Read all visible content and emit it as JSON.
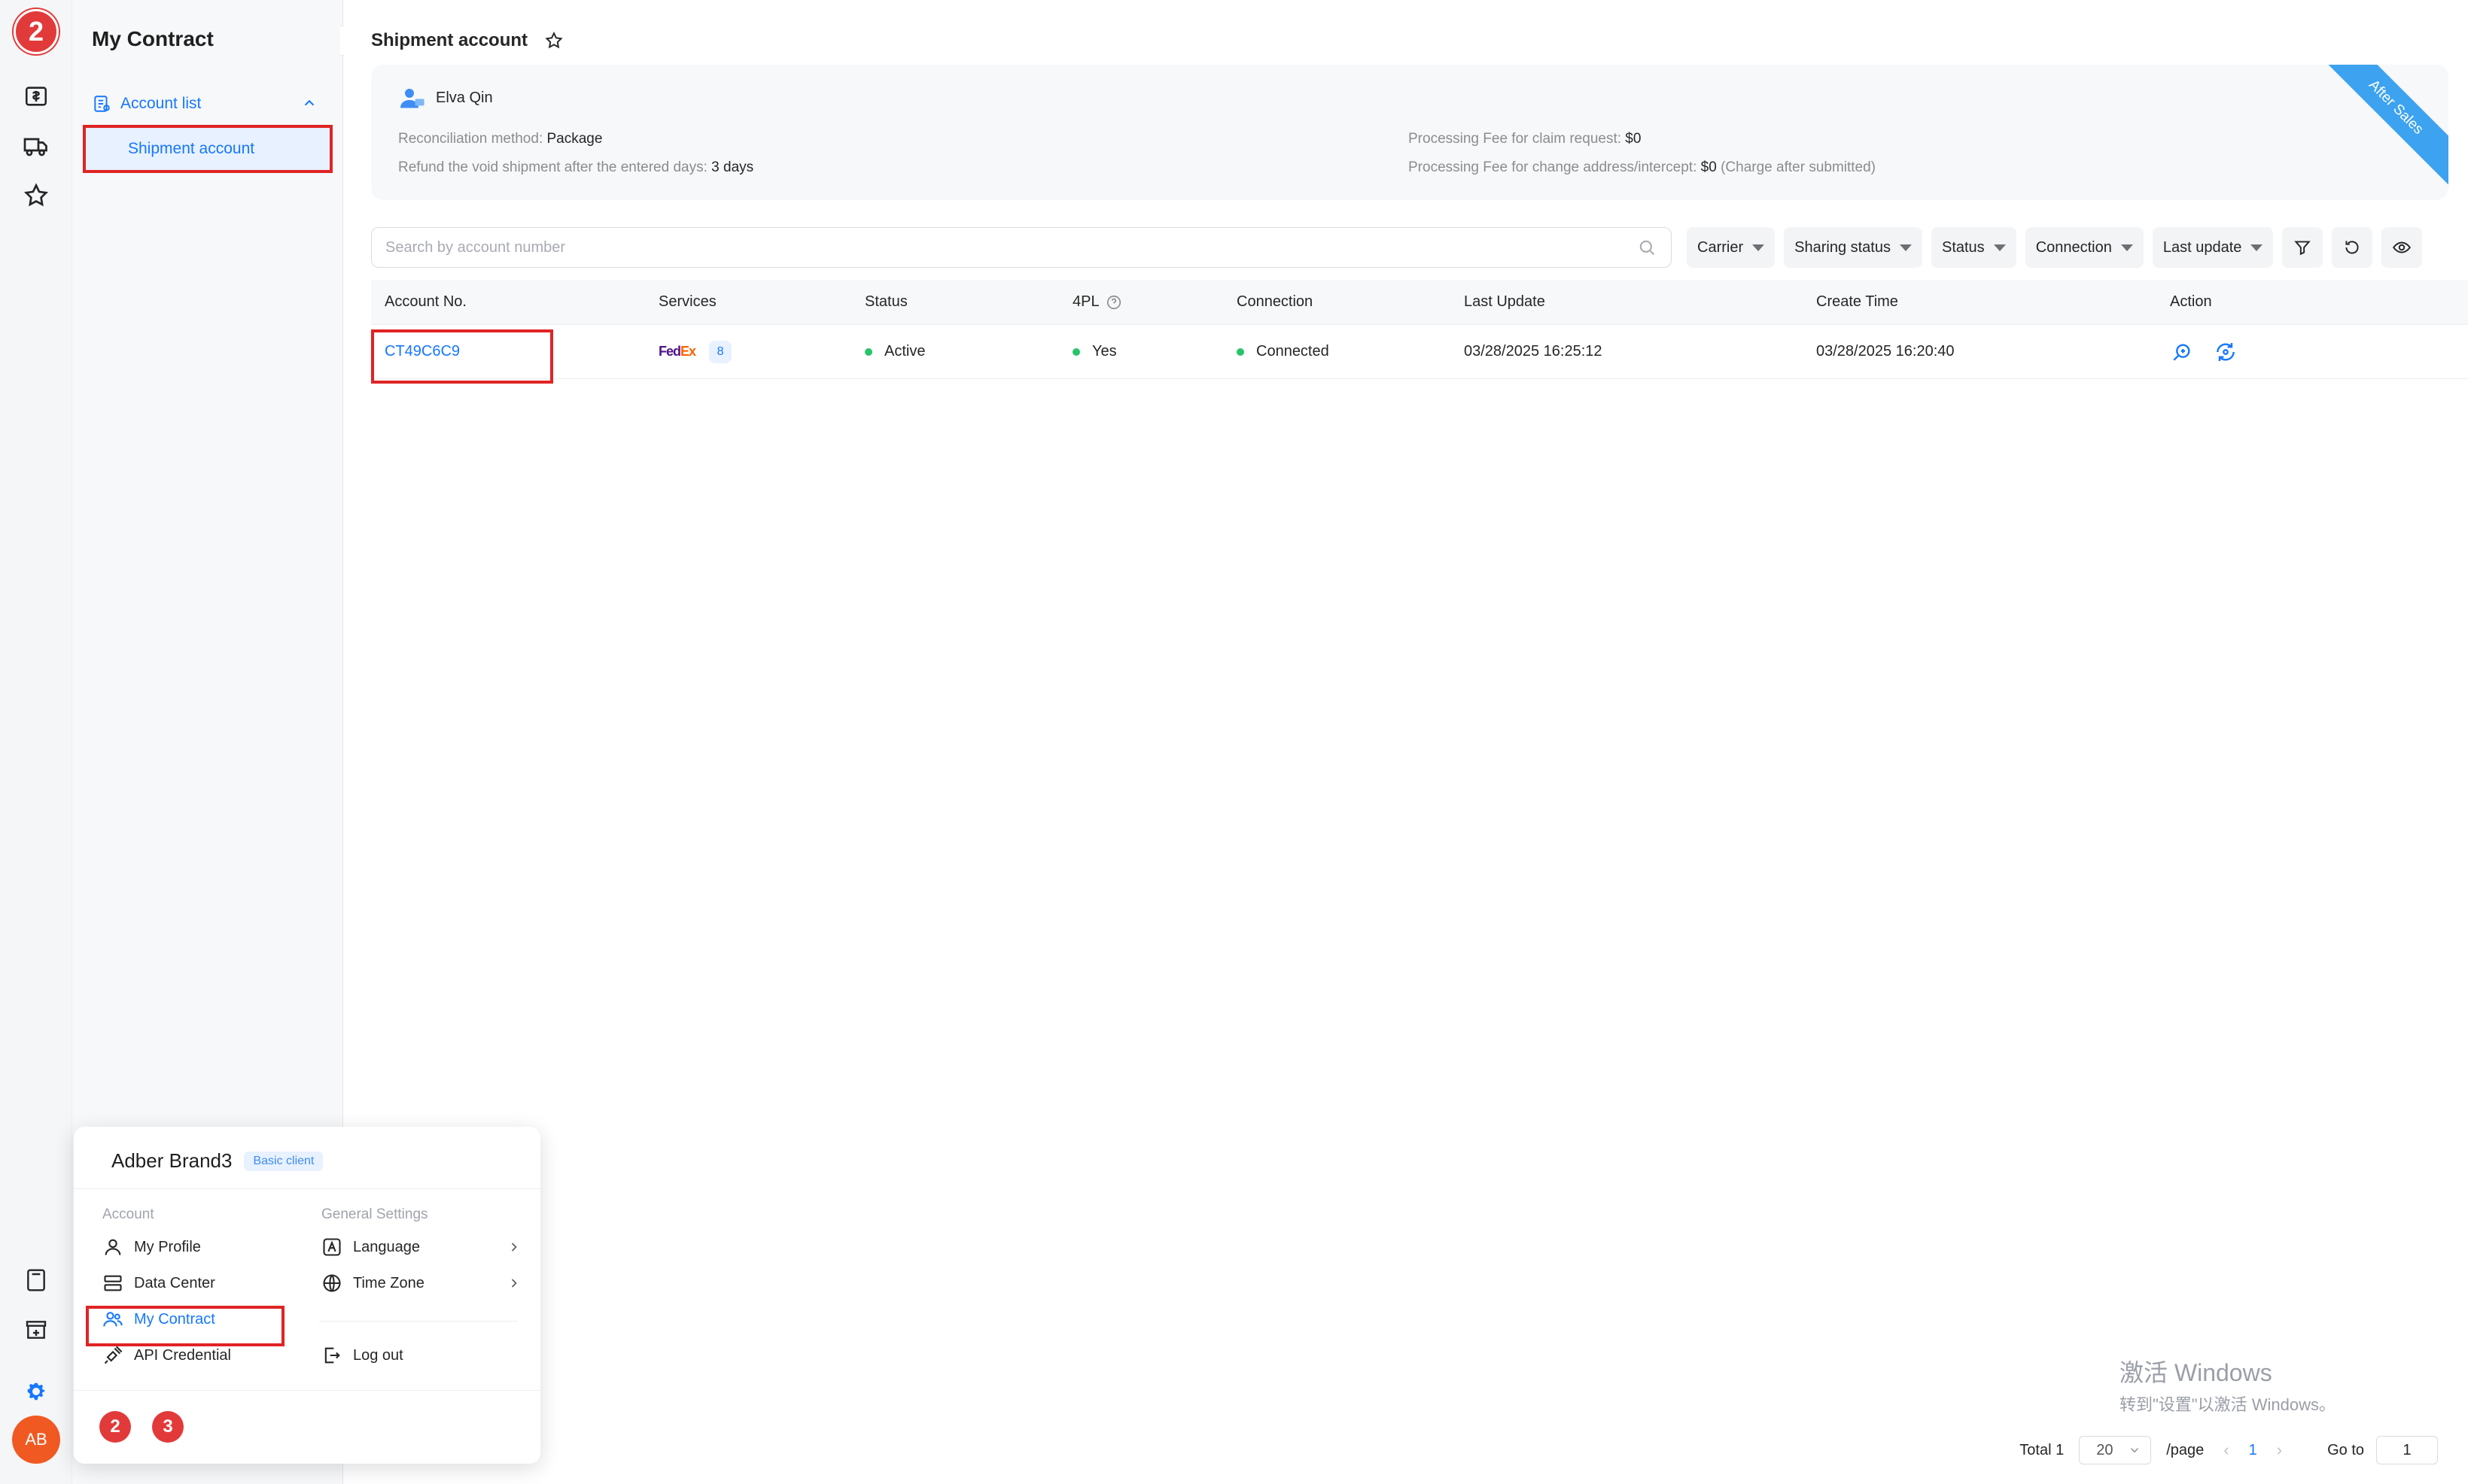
{
  "rail": {
    "badge": "2",
    "icons": [
      "billing-icon",
      "truck-icon",
      "star-icon",
      "calculator-icon",
      "store-icon",
      "settings-gear-icon"
    ],
    "avatar_text": "AB"
  },
  "subnav": {
    "title": "My Contract",
    "group_label": "Account list",
    "item_label": "Shipment account"
  },
  "main": {
    "page_title": "Shipment account",
    "info": {
      "owner": "Elva Qin",
      "reconciliation_label": "Reconciliation method:",
      "reconciliation_value": "Package",
      "refund_label": "Refund the void shipment after the entered days:",
      "refund_value": "3 days",
      "claim_fee_label": "Processing Fee for claim request:",
      "claim_fee_value": "$0",
      "change_fee_label": "Processing Fee for change address/intercept:",
      "change_fee_value": "$0",
      "change_fee_note": "(Charge after submitted)",
      "ribbon": "After Sales"
    },
    "search": {
      "placeholder": "Search by account number"
    },
    "filters": [
      "Carrier",
      "Sharing status",
      "Status",
      "Connection",
      "Last update"
    ],
    "table": {
      "headers": [
        "Account No.",
        "Services",
        "Status",
        "4PL",
        "Connection",
        "Last Update",
        "Create Time",
        "Action"
      ],
      "rows": [
        {
          "account_no": "CT49C6C9",
          "carrier_logo_fe": "Fed",
          "carrier_logo_ex": "Ex",
          "services_count": "8",
          "status": "Active",
          "fourpl": "Yes",
          "connection": "Connected",
          "last_update": "03/28/2025 16:25:12",
          "create_time": "03/28/2025 16:20:40"
        }
      ]
    },
    "pagination": {
      "total_label": "Total 1",
      "page_size": "20",
      "per_page_label": "/page",
      "current_page": "1",
      "goto_label": "Go to",
      "goto_value": "1"
    }
  },
  "watermark": {
    "line1": "激活 Windows",
    "line2": "转到\"设置\"以激活 Windows。"
  },
  "popover": {
    "name": "Adber Brand3",
    "tag": "Basic client",
    "account_section": "Account",
    "general_section": "General Settings",
    "account_items": [
      "My Profile",
      "Data Center",
      "My Contract",
      "API Credential"
    ],
    "general_items": [
      "Language",
      "Time Zone",
      "Log out"
    ],
    "step_badges": [
      "2",
      "3"
    ]
  },
  "colors": {
    "accent": "#1677ff",
    "highlight_red": "#e02424",
    "badge_red": "#e23a3a",
    "success": "#29c46a",
    "ribbon": "#3da2f0",
    "avatar": "#f05a22"
  }
}
